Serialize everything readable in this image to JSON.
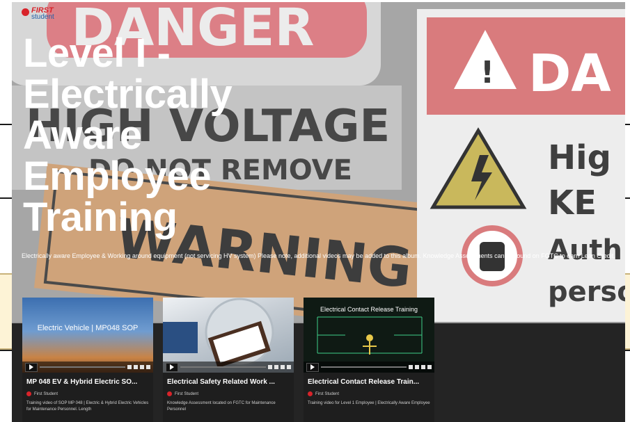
{
  "album": {
    "title": "Level I - Electrically Aware Employee Training",
    "description": "Electrically aware Employee & Working around equipment (not servicing HV system) Please note, additional videos may be added to this album. Knowledge Assessments can be found on FGTC to earn Lean Credit."
  },
  "logo": {
    "first": "FIRST",
    "student": "student"
  },
  "background": {
    "sign_danger": "DANGER",
    "sign_high_voltage": "HIGH VOLTAGE",
    "sign_do_not_remove": "DO NOT REMOVE",
    "sign_warning": "WARNING",
    "sign_da": "DA",
    "sign_high": "Hig",
    "sign_ke": "KE",
    "sign_auth": "Auth",
    "sign_perso": "perso"
  },
  "colors": {
    "brand_red": "#d8232a",
    "panel_dark": "#242424",
    "card_bg": "#1e1e1e"
  },
  "videos": [
    {
      "thumb_label": "Electric Vehicle | MP048 SOP",
      "title": "MP 048 EV & Hybrid Electric SO...",
      "author": "First Student",
      "description": "Training video of SOP MP 048 | Electric & Hybrid Electric Vehicles for Maintenance Personnel. Length"
    },
    {
      "thumb_label": "",
      "title": "Electrical Safety Related Work ...",
      "author": "First Student",
      "description": "Knowledge Assessment located on FGTC for Maintenance Personnel"
    },
    {
      "thumb_label": "Electrical Contact Release Training",
      "title": "Electrical Contact Release Train...",
      "author": "First Student",
      "description": "Training video for Level 1 Employee | Electrically Aware Employee"
    }
  ]
}
